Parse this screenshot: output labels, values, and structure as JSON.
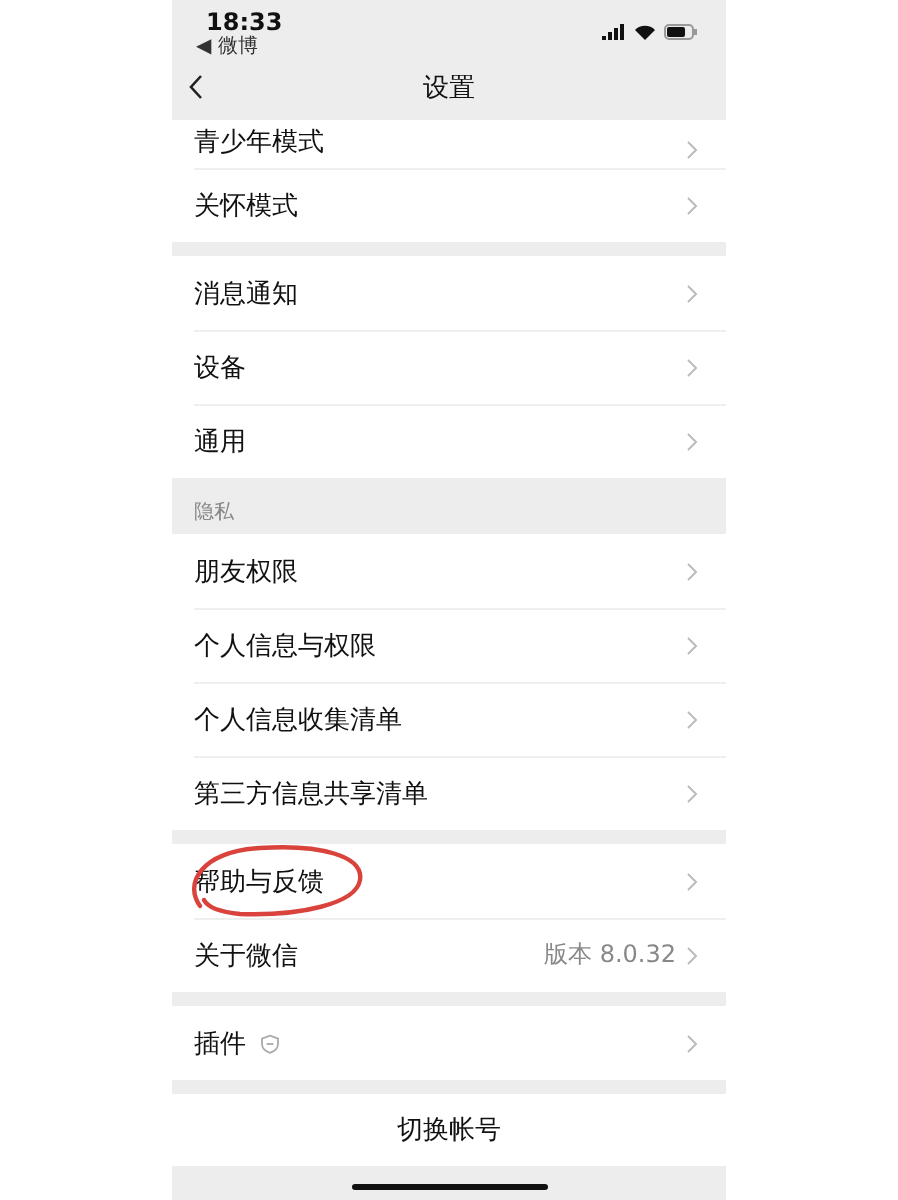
{
  "status_bar": {
    "time": "18:33",
    "back_app": "◀ 微博"
  },
  "nav": {
    "title": "设置"
  },
  "groups": [
    {
      "items": [
        {
          "label": "青少年模式",
          "kind": "partial",
          "has_icon": false,
          "circled": false
        },
        {
          "label": "关怀模式",
          "kind": "row",
          "has_icon": false,
          "circled": false
        }
      ]
    },
    {
      "items": [
        {
          "label": "消息通知",
          "kind": "row",
          "has_icon": false,
          "circled": false
        },
        {
          "label": "设备",
          "kind": "row",
          "has_icon": false,
          "circled": false
        },
        {
          "label": "通用",
          "kind": "row",
          "has_icon": false,
          "circled": false
        }
      ]
    },
    {
      "header": "隐私",
      "items": [
        {
          "label": "朋友权限",
          "kind": "row",
          "has_icon": false,
          "circled": false
        },
        {
          "label": "个人信息与权限",
          "kind": "row",
          "has_icon": false,
          "circled": false
        },
        {
          "label": "个人信息收集清单",
          "kind": "row",
          "has_icon": false,
          "circled": false
        },
        {
          "label": "第三方信息共享清单",
          "kind": "row",
          "has_icon": false,
          "circled": false
        }
      ]
    },
    {
      "items": [
        {
          "label": "帮助与反馈",
          "kind": "row",
          "has_icon": false,
          "circled": true
        },
        {
          "label": "关于微信",
          "kind": "row",
          "value": "版本 8.0.32",
          "has_icon": false,
          "circled": false
        }
      ]
    },
    {
      "items": [
        {
          "label": "插件",
          "kind": "row",
          "has_icon": true,
          "circled": false
        }
      ]
    }
  ],
  "switch_account": {
    "label": "切换帐号"
  }
}
